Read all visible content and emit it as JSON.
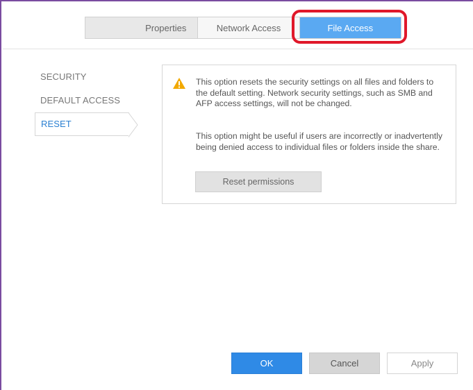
{
  "tabs": [
    {
      "label": "Properties",
      "active": false
    },
    {
      "label": "Network Access",
      "active": false
    },
    {
      "label": "File Access",
      "active": true
    }
  ],
  "sidebar": {
    "items": [
      {
        "label": "SECURITY",
        "selected": false
      },
      {
        "label": "DEFAULT ACCESS",
        "selected": false
      },
      {
        "label": "RESET",
        "selected": true
      }
    ]
  },
  "panel": {
    "icon": "warning-icon",
    "paragraph1": "This option resets the security settings on all files and folders to the default setting. Network security settings, such as SMB and AFP access settings, will not be changed.",
    "paragraph2": "This option might be useful if users are incorrectly or inadvertently being denied access to individual files or folders inside the share.",
    "reset_button_label": "Reset permissions"
  },
  "footer": {
    "ok_label": "OK",
    "cancel_label": "Cancel",
    "apply_label": "Apply"
  },
  "colors": {
    "accent": "#2f8ae6",
    "active_tab": "#5aa9f2",
    "highlight": "#e0182a",
    "warning": "#f2a900",
    "frame_border": "#7a4ba0"
  }
}
